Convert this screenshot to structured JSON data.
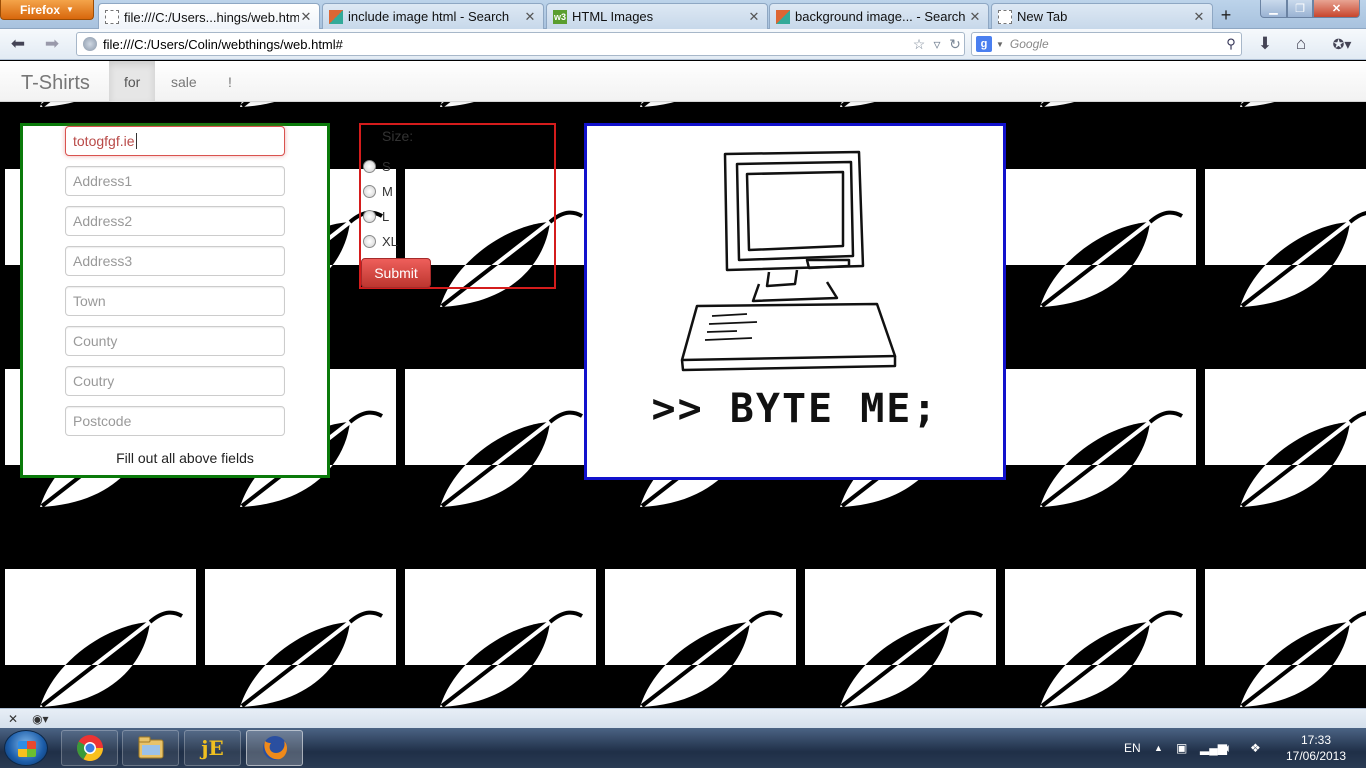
{
  "browser": {
    "app_button": "Firefox",
    "tabs": [
      {
        "title": "file:///C:/Users...hings/web.html#",
        "icon": "document-icon",
        "active": true
      },
      {
        "title": "include image html - Search",
        "icon": "bing-icon",
        "active": false
      },
      {
        "title": "HTML Images",
        "icon": "w3schools-icon",
        "active": false
      },
      {
        "title": "background image... - Search",
        "icon": "bing-icon",
        "active": false
      },
      {
        "title": "New Tab",
        "icon": "document-icon",
        "active": false
      }
    ],
    "url": "file:///C:/Users/Colin/webthings/web.html#",
    "search_placeholder": "Google"
  },
  "page": {
    "brand": "T-Shirts",
    "nav": [
      {
        "label": "for",
        "active": true
      },
      {
        "label": "sale",
        "active": false
      },
      {
        "label": "!",
        "active": false
      }
    ],
    "address_form": {
      "fields": [
        {
          "name": "email",
          "value": "totogfgf.ie",
          "placeholder": "",
          "error": true
        },
        {
          "name": "address1",
          "value": "",
          "placeholder": "Address1"
        },
        {
          "name": "address2",
          "value": "",
          "placeholder": "Address2"
        },
        {
          "name": "address3",
          "value": "",
          "placeholder": "Address3"
        },
        {
          "name": "town",
          "value": "",
          "placeholder": "Town"
        },
        {
          "name": "county",
          "value": "",
          "placeholder": "County"
        },
        {
          "name": "country",
          "value": "",
          "placeholder": "Coutry"
        },
        {
          "name": "postcode",
          "value": "",
          "placeholder": "Postcode"
        }
      ],
      "note": "Fill out all above fields"
    },
    "size_form": {
      "label": "Size:",
      "options": [
        "S",
        "M",
        "L",
        "XL"
      ],
      "submit_label": "Submit"
    },
    "image": {
      "caption": ">> BYTE ME;"
    },
    "colors": {
      "address_border": "#0a7a0a",
      "size_border": "#d41c1c",
      "image_border": "#1111cc",
      "submit_bg": "#da4f49"
    }
  },
  "taskbar": {
    "apps": [
      "chrome-icon",
      "explorer-icon",
      "jedit-icon",
      "firefox-icon"
    ],
    "language": "EN",
    "time": "17:33",
    "date": "17/06/2013"
  }
}
